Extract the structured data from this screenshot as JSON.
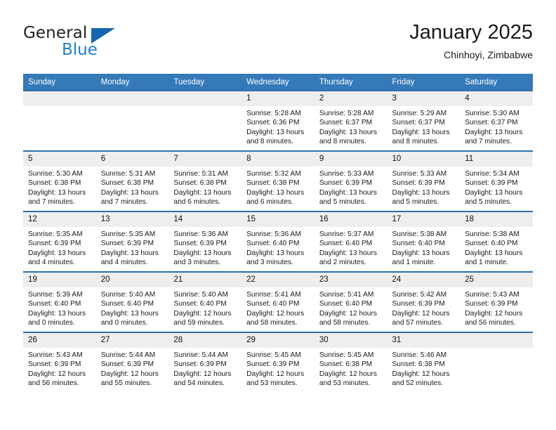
{
  "brand": {
    "word1": "General",
    "word2": "Blue",
    "logo_icon": "blue-triangle-logo"
  },
  "header": {
    "title": "January 2025",
    "subtitle": "Chinhoyi, Zimbabwe",
    "accent_color": "#3479b8",
    "row_border_color": "#2f6fa8",
    "daynum_bg": "#eeeeee"
  },
  "weekdays": [
    "Sunday",
    "Monday",
    "Tuesday",
    "Wednesday",
    "Thursday",
    "Friday",
    "Saturday"
  ],
  "labels": {
    "sunrise": "Sunrise:",
    "sunset": "Sunset:",
    "daylight": "Daylight:"
  },
  "weeks": [
    [
      {
        "day": ""
      },
      {
        "day": ""
      },
      {
        "day": ""
      },
      {
        "day": "1",
        "sunrise": "Sunrise: 5:28 AM",
        "sunset": "Sunset: 6:36 PM",
        "daylight_1": "Daylight: 13 hours",
        "daylight_2": "and 8 minutes."
      },
      {
        "day": "2",
        "sunrise": "Sunrise: 5:28 AM",
        "sunset": "Sunset: 6:37 PM",
        "daylight_1": "Daylight: 13 hours",
        "daylight_2": "and 8 minutes."
      },
      {
        "day": "3",
        "sunrise": "Sunrise: 5:29 AM",
        "sunset": "Sunset: 6:37 PM",
        "daylight_1": "Daylight: 13 hours",
        "daylight_2": "and 8 minutes."
      },
      {
        "day": "4",
        "sunrise": "Sunrise: 5:30 AM",
        "sunset": "Sunset: 6:37 PM",
        "daylight_1": "Daylight: 13 hours",
        "daylight_2": "and 7 minutes."
      }
    ],
    [
      {
        "day": "5",
        "sunrise": "Sunrise: 5:30 AM",
        "sunset": "Sunset: 6:38 PM",
        "daylight_1": "Daylight: 13 hours",
        "daylight_2": "and 7 minutes."
      },
      {
        "day": "6",
        "sunrise": "Sunrise: 5:31 AM",
        "sunset": "Sunset: 6:38 PM",
        "daylight_1": "Daylight: 13 hours",
        "daylight_2": "and 7 minutes."
      },
      {
        "day": "7",
        "sunrise": "Sunrise: 5:31 AM",
        "sunset": "Sunset: 6:38 PM",
        "daylight_1": "Daylight: 13 hours",
        "daylight_2": "and 6 minutes."
      },
      {
        "day": "8",
        "sunrise": "Sunrise: 5:32 AM",
        "sunset": "Sunset: 6:38 PM",
        "daylight_1": "Daylight: 13 hours",
        "daylight_2": "and 6 minutes."
      },
      {
        "day": "9",
        "sunrise": "Sunrise: 5:33 AM",
        "sunset": "Sunset: 6:39 PM",
        "daylight_1": "Daylight: 13 hours",
        "daylight_2": "and 5 minutes."
      },
      {
        "day": "10",
        "sunrise": "Sunrise: 5:33 AM",
        "sunset": "Sunset: 6:39 PM",
        "daylight_1": "Daylight: 13 hours",
        "daylight_2": "and 5 minutes."
      },
      {
        "day": "11",
        "sunrise": "Sunrise: 5:34 AM",
        "sunset": "Sunset: 6:39 PM",
        "daylight_1": "Daylight: 13 hours",
        "daylight_2": "and 5 minutes."
      }
    ],
    [
      {
        "day": "12",
        "sunrise": "Sunrise: 5:35 AM",
        "sunset": "Sunset: 6:39 PM",
        "daylight_1": "Daylight: 13 hours",
        "daylight_2": "and 4 minutes."
      },
      {
        "day": "13",
        "sunrise": "Sunrise: 5:35 AM",
        "sunset": "Sunset: 6:39 PM",
        "daylight_1": "Daylight: 13 hours",
        "daylight_2": "and 4 minutes."
      },
      {
        "day": "14",
        "sunrise": "Sunrise: 5:36 AM",
        "sunset": "Sunset: 6:39 PM",
        "daylight_1": "Daylight: 13 hours",
        "daylight_2": "and 3 minutes."
      },
      {
        "day": "15",
        "sunrise": "Sunrise: 5:36 AM",
        "sunset": "Sunset: 6:40 PM",
        "daylight_1": "Daylight: 13 hours",
        "daylight_2": "and 3 minutes."
      },
      {
        "day": "16",
        "sunrise": "Sunrise: 5:37 AM",
        "sunset": "Sunset: 6:40 PM",
        "daylight_1": "Daylight: 13 hours",
        "daylight_2": "and 2 minutes."
      },
      {
        "day": "17",
        "sunrise": "Sunrise: 5:38 AM",
        "sunset": "Sunset: 6:40 PM",
        "daylight_1": "Daylight: 13 hours",
        "daylight_2": "and 1 minute."
      },
      {
        "day": "18",
        "sunrise": "Sunrise: 5:38 AM",
        "sunset": "Sunset: 6:40 PM",
        "daylight_1": "Daylight: 13 hours",
        "daylight_2": "and 1 minute."
      }
    ],
    [
      {
        "day": "19",
        "sunrise": "Sunrise: 5:39 AM",
        "sunset": "Sunset: 6:40 PM",
        "daylight_1": "Daylight: 13 hours",
        "daylight_2": "and 0 minutes."
      },
      {
        "day": "20",
        "sunrise": "Sunrise: 5:40 AM",
        "sunset": "Sunset: 6:40 PM",
        "daylight_1": "Daylight: 13 hours",
        "daylight_2": "and 0 minutes."
      },
      {
        "day": "21",
        "sunrise": "Sunrise: 5:40 AM",
        "sunset": "Sunset: 6:40 PM",
        "daylight_1": "Daylight: 12 hours",
        "daylight_2": "and 59 minutes."
      },
      {
        "day": "22",
        "sunrise": "Sunrise: 5:41 AM",
        "sunset": "Sunset: 6:40 PM",
        "daylight_1": "Daylight: 12 hours",
        "daylight_2": "and 58 minutes."
      },
      {
        "day": "23",
        "sunrise": "Sunrise: 5:41 AM",
        "sunset": "Sunset: 6:40 PM",
        "daylight_1": "Daylight: 12 hours",
        "daylight_2": "and 58 minutes."
      },
      {
        "day": "24",
        "sunrise": "Sunrise: 5:42 AM",
        "sunset": "Sunset: 6:39 PM",
        "daylight_1": "Daylight: 12 hours",
        "daylight_2": "and 57 minutes."
      },
      {
        "day": "25",
        "sunrise": "Sunrise: 5:43 AM",
        "sunset": "Sunset: 6:39 PM",
        "daylight_1": "Daylight: 12 hours",
        "daylight_2": "and 56 minutes."
      }
    ],
    [
      {
        "day": "26",
        "sunrise": "Sunrise: 5:43 AM",
        "sunset": "Sunset: 6:39 PM",
        "daylight_1": "Daylight: 12 hours",
        "daylight_2": "and 56 minutes."
      },
      {
        "day": "27",
        "sunrise": "Sunrise: 5:44 AM",
        "sunset": "Sunset: 6:39 PM",
        "daylight_1": "Daylight: 12 hours",
        "daylight_2": "and 55 minutes."
      },
      {
        "day": "28",
        "sunrise": "Sunrise: 5:44 AM",
        "sunset": "Sunset: 6:39 PM",
        "daylight_1": "Daylight: 12 hours",
        "daylight_2": "and 54 minutes."
      },
      {
        "day": "29",
        "sunrise": "Sunrise: 5:45 AM",
        "sunset": "Sunset: 6:39 PM",
        "daylight_1": "Daylight: 12 hours",
        "daylight_2": "and 53 minutes."
      },
      {
        "day": "30",
        "sunrise": "Sunrise: 5:45 AM",
        "sunset": "Sunset: 6:38 PM",
        "daylight_1": "Daylight: 12 hours",
        "daylight_2": "and 53 minutes."
      },
      {
        "day": "31",
        "sunrise": "Sunrise: 5:46 AM",
        "sunset": "Sunset: 6:38 PM",
        "daylight_1": "Daylight: 12 hours",
        "daylight_2": "and 52 minutes."
      },
      {
        "day": ""
      }
    ]
  ]
}
